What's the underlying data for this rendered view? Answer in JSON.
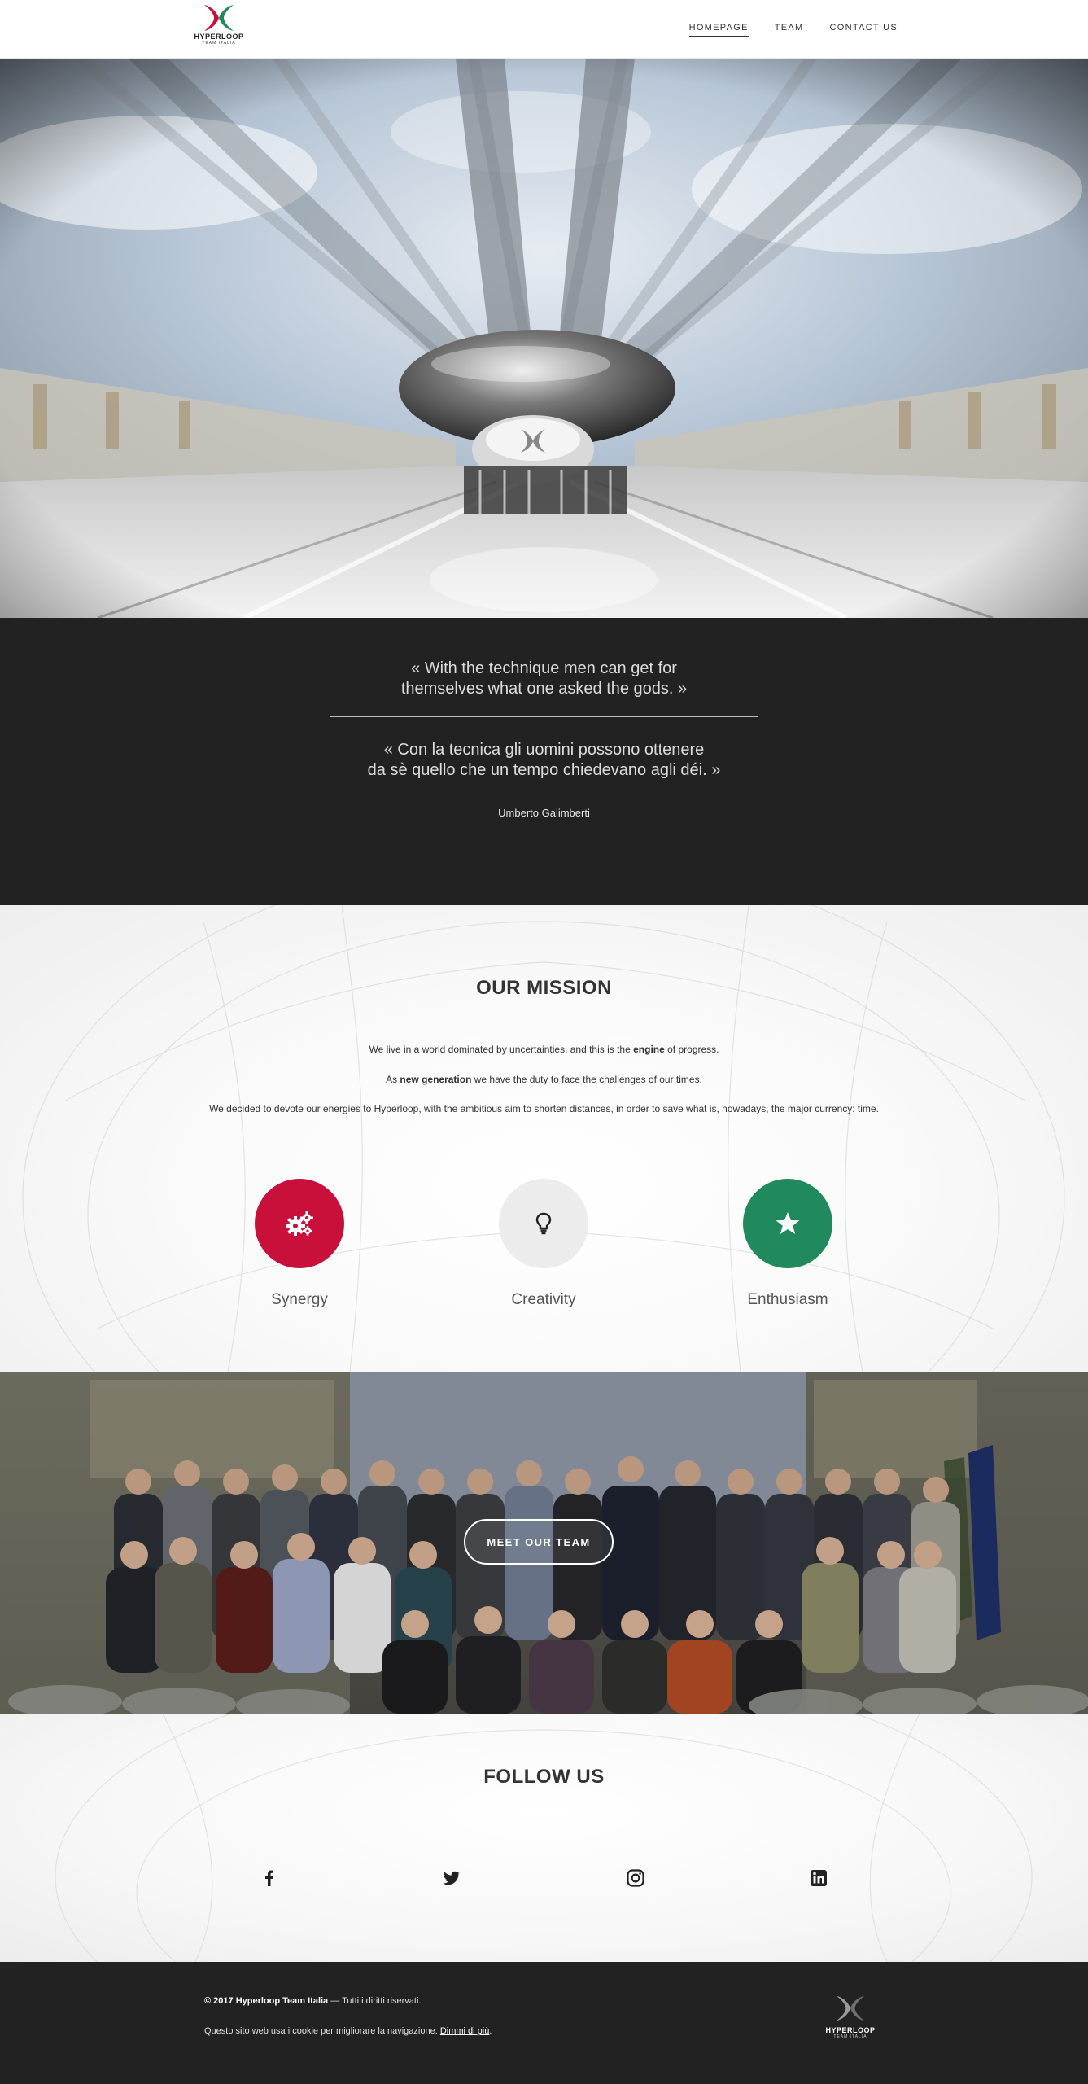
{
  "nav": {
    "logo_text": "HYPERLOOP",
    "logo_sub": "TEAM ITALIA",
    "items": [
      {
        "label": "HOMEPAGE",
        "active": true
      },
      {
        "label": "TEAM",
        "active": false
      },
      {
        "label": "CONTACT US",
        "active": false
      }
    ]
  },
  "quote": {
    "english_line1": "« With the technique men can get for",
    "english_line2": "themselves what one asked the gods. »",
    "italian_line1": "« Con la tecnica gli uomini possono ottenere",
    "italian_line2": "da sè quello che un tempo chiedevano agli déi. »",
    "author": "Umberto Galimberti"
  },
  "mission": {
    "title": "OUR MISSION",
    "p1_before": "We live in a world dominated by uncertainties, and this is the ",
    "p1_bold": "engine",
    "p1_after": " of progress.",
    "p2_before": "As ",
    "p2_bold": "new generation",
    "p2_after": " we have the duty to face the challenges of our times.",
    "p3": "We decided to devote our energies to Hyperloop, with the ambitious aim to shorten distances, in order to save what is, nowadays, the major currency: time.",
    "features": [
      {
        "label": "Synergy",
        "icon": "gears-icon",
        "color": "#c8103a"
      },
      {
        "label": "Creativity",
        "icon": "lightbulb-icon",
        "color": "#ececec"
      },
      {
        "label": "Enthusiasm",
        "icon": "star-icon",
        "color": "#20895e"
      }
    ]
  },
  "team": {
    "button_label": "MEET OUR TEAM"
  },
  "follow": {
    "title": "FOLLOW US",
    "icons": [
      "facebook-icon",
      "twitter-icon",
      "instagram-icon",
      "linkedin-icon"
    ]
  },
  "footer": {
    "copyright_bold": "© 2017 Hyperloop Team Italia",
    "copyright_rest": " — Tutti i diritti riservati.",
    "cookie_text": "Questo sito web usa i cookie per migliorare la navigazione. ",
    "cookie_link": "Dimmi di più",
    "cookie_end": ".",
    "logo_text": "HYPERLOOP",
    "logo_sub": "TEAM ITALIA"
  },
  "colors": {
    "brand_red": "#c8103a",
    "brand_green": "#20895e",
    "dark": "#222222"
  }
}
